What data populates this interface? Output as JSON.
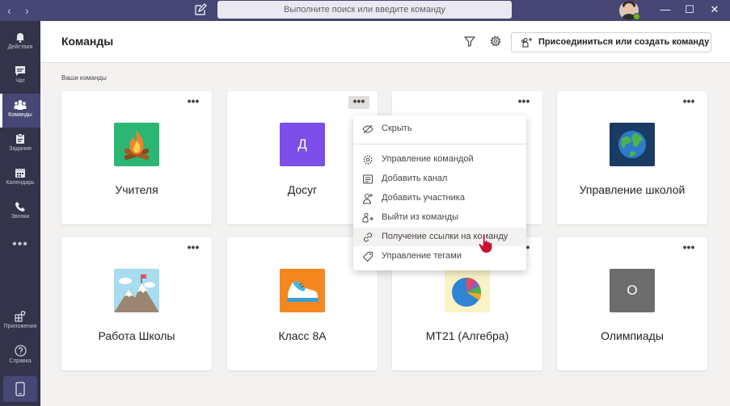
{
  "search": {
    "placeholder": "Выполните поиск или введите команду"
  },
  "nav": {
    "back": "‹",
    "forward": "›"
  },
  "window": {
    "minimize": "—",
    "maximize": "☐",
    "close": "✕"
  },
  "rail": {
    "items": [
      {
        "label": "Действия",
        "icon": "bell-icon"
      },
      {
        "label": "Чат",
        "icon": "chat-icon"
      },
      {
        "label": "Команды",
        "icon": "teams-icon",
        "active": true
      },
      {
        "label": "Задания",
        "icon": "assignments-icon"
      },
      {
        "label": "Календарь",
        "icon": "calendar-icon"
      },
      {
        "label": "Звонки",
        "icon": "phone-icon"
      }
    ],
    "more": "•••",
    "apps_label": "Приложения",
    "help_label": "Справка"
  },
  "header": {
    "title": "Команды",
    "join_label": "Присоединиться или создать команду"
  },
  "section_label": "Ваши команды",
  "teams": [
    {
      "name": "Учителя",
      "tile": "campfire",
      "color": "#2bb673"
    },
    {
      "name": "Досуг",
      "tile": "letter",
      "letter": "Д",
      "color": "#7b4fe8"
    },
    {
      "name": "",
      "tile": "hidden",
      "color": "#ffffff"
    },
    {
      "name": "Управление школой",
      "tile": "globe",
      "color": "#1a3b63"
    },
    {
      "name": "Работа Школы",
      "tile": "mountain",
      "color": "#9fd5ea"
    },
    {
      "name": "Класс 8А",
      "tile": "shoe",
      "color": "#f5871f"
    },
    {
      "name": "МТ21 (Алгебра)",
      "tile": "pie",
      "color": "#f9f3c6"
    },
    {
      "name": "Олимпиады",
      "tile": "letter",
      "letter": "О",
      "color": "#6d6d6d"
    }
  ],
  "card_more": "•••",
  "menu": {
    "items": [
      {
        "label": "Скрыть",
        "icon": "hide-icon"
      },
      {
        "label": "Управление командой",
        "icon": "gear-icon"
      },
      {
        "label": "Добавить канал",
        "icon": "add-channel-icon"
      },
      {
        "label": "Добавить участника",
        "icon": "add-member-icon"
      },
      {
        "label": "Выйти из команды",
        "icon": "leave-icon"
      },
      {
        "label": "Получение ссылки на команду",
        "icon": "link-icon"
      },
      {
        "label": "Управление тегами",
        "icon": "tag-icon"
      }
    ]
  },
  "colors": {
    "titlebar": "#464775",
    "rail": "#33344a",
    "accent": "#6264a7",
    "presence": "#6bb700"
  }
}
